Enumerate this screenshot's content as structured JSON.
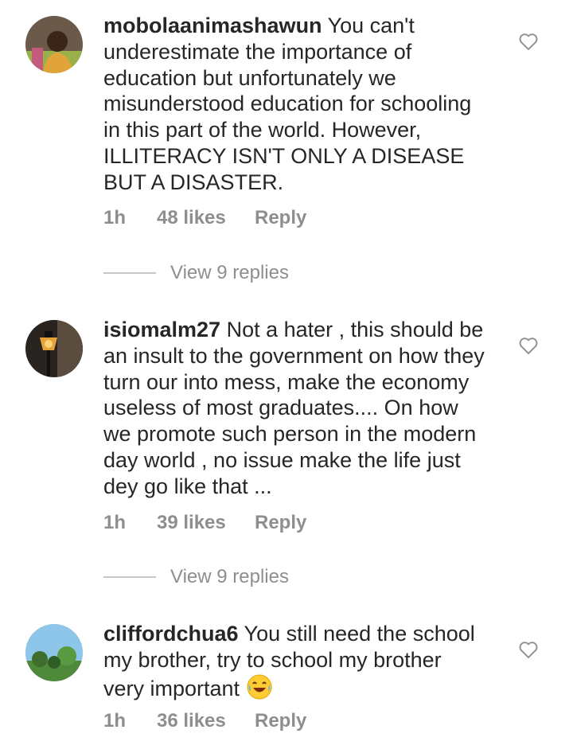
{
  "comments": [
    {
      "username": "mobolaanimashawun",
      "text": " You can't\nunderestimate the importance of\neducation but unfortunately we\nmisunderstood education for schooling\nin this part of the world. However,\nILLITERACY ISN'T ONLY A DISEASE\nBUT A DISASTER.",
      "time": "1h",
      "likes": "48 likes",
      "reply": "Reply",
      "view_replies": "View 9 replies",
      "avatar_icon": "avatar-woman-photo"
    },
    {
      "username": "isiomalm27",
      "text": " Not a hater , this should be\nan insult to the government on how they\nturn our into mess, make the economy\nuseless of most graduates.... On how\nwe promote such person in the modern\nday world , no issue make the life just\ndey go like that ...",
      "time": "1h",
      "likes": "39 likes",
      "reply": "Reply",
      "view_replies": "View 9 replies",
      "avatar_icon": "avatar-lamp-photo"
    },
    {
      "username": "cliffordchua6",
      "text": " You still need the school\nmy brother, try to school my brother\nvery important",
      "emoji": "tears-of-joy-emoji",
      "time": "1h",
      "likes": "36 likes",
      "reply": "Reply",
      "avatar_icon": "avatar-landscape-photo"
    }
  ],
  "icons": {
    "like": "heart-outline-icon"
  },
  "colors": {
    "text": "#262626",
    "meta": "#8e8e8e",
    "divider": "#c7c7c7"
  }
}
